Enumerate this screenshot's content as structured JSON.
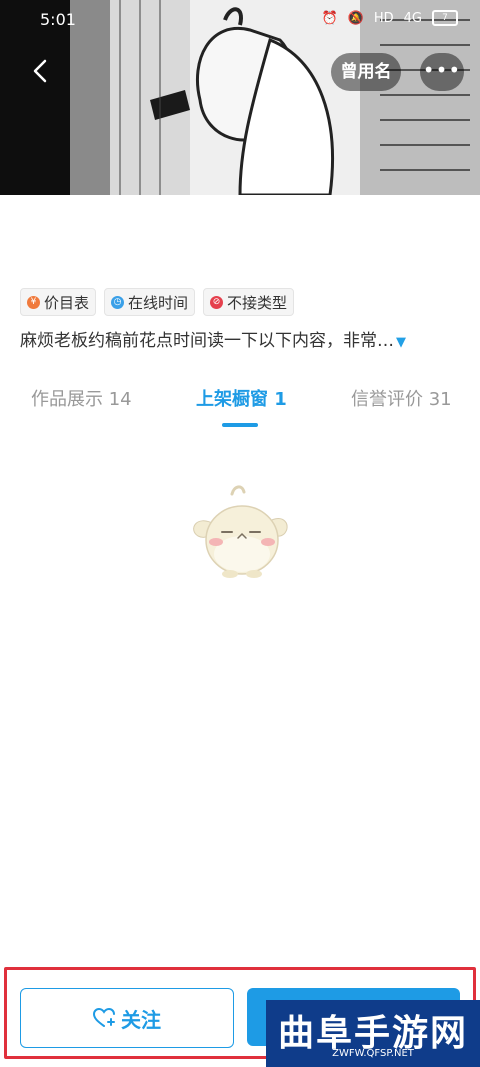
{
  "status_bar": {
    "time": "5:01",
    "network": "4G",
    "hd": "HD",
    "battery": "7"
  },
  "header": {
    "alias_button": "曾用名",
    "more_button": "•••"
  },
  "tags": [
    {
      "icon": "price-icon",
      "label": "价目表",
      "color": "#f07a3c"
    },
    {
      "icon": "clock-icon",
      "label": "在线时间",
      "color": "#3aa0e8"
    },
    {
      "icon": "forbidden-icon",
      "label": "不接类型",
      "color": "#e5404d"
    }
  ],
  "description": {
    "text": "麻烦老板约稿前花点时间读一下以下内容，非常…",
    "expand_icon": "triangle-down-icon"
  },
  "tabs": [
    {
      "label": "作品展示 14",
      "active": false
    },
    {
      "label": "上架橱窗 1",
      "active": true
    },
    {
      "label": "信誉评价 31",
      "active": false
    }
  ],
  "bottom": {
    "follow_label": "关注"
  },
  "watermark": {
    "title": "曲阜手游网",
    "url": "ZWFW.QFSP.NET"
  },
  "colors": {
    "accent": "#1e9be5",
    "highlight": "#e0303c",
    "watermark_bg": "#0f3c8a"
  }
}
